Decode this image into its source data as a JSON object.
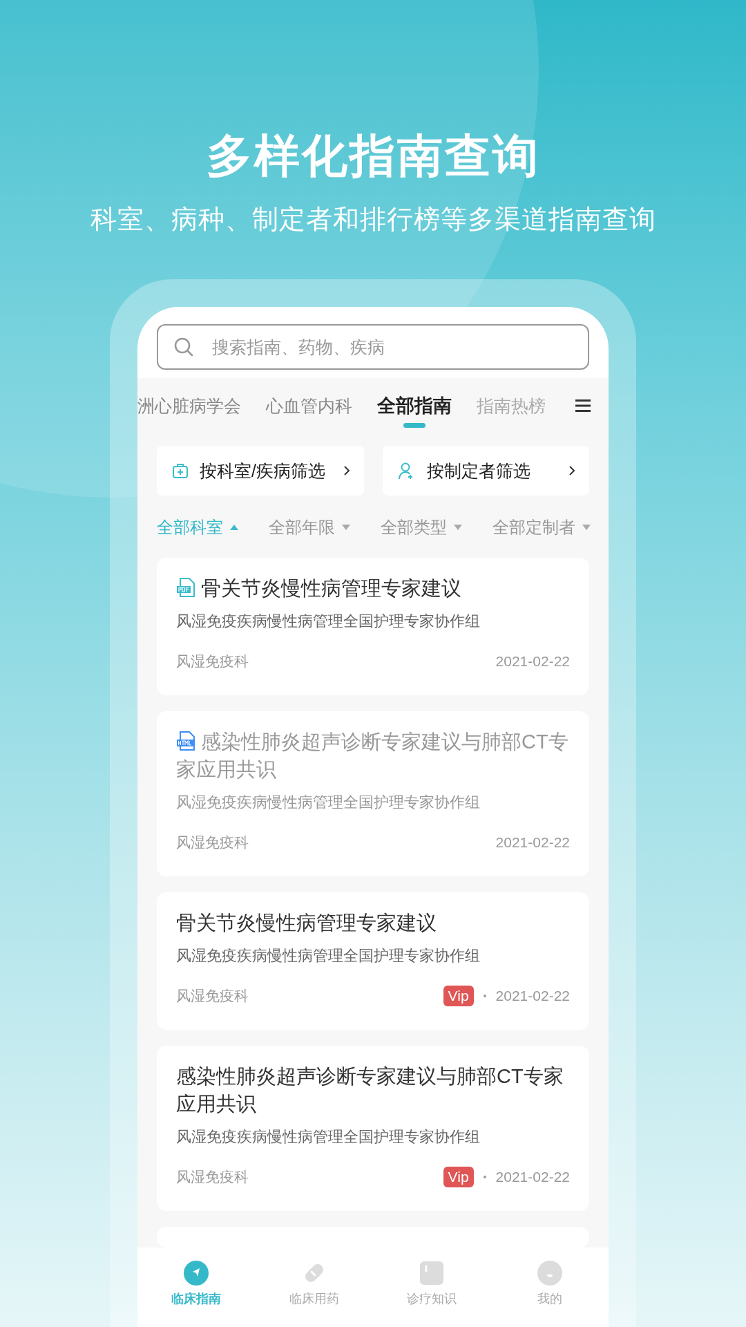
{
  "header": {
    "title": "多样化指南查询",
    "subtitle": "科室、病种、制定者和排行榜等多渠道指南查询"
  },
  "search": {
    "placeholder": "搜索指南、药物、疾病"
  },
  "tabs": [
    {
      "label": "洲心脏病学会",
      "selected": false
    },
    {
      "label": "心血管内科",
      "selected": false
    },
    {
      "label": "全部指南",
      "selected": true
    },
    {
      "label": "指南热榜",
      "selected": false
    }
  ],
  "filter_buttons": [
    {
      "label": "按科室/疾病筛选",
      "kind": "department"
    },
    {
      "label": "按制定者筛选",
      "kind": "author"
    }
  ],
  "dropdowns": [
    {
      "label": "全部科室",
      "expanded": true
    },
    {
      "label": "全部年限",
      "expanded": false
    },
    {
      "label": "全部类型",
      "expanded": false
    },
    {
      "label": "全部定制者",
      "expanded": false
    }
  ],
  "guidelines": [
    {
      "title": "骨关节炎慢性病管理专家建议",
      "org": "风湿免疫疾病慢性病管理全国护理专家协作组",
      "department": "风湿免疫科",
      "date": "2021-02-22",
      "kind": "pdf",
      "vip": false,
      "read": false
    },
    {
      "title": "感染性肺炎超声诊断专家建议与肺部CT专家应用共识",
      "org": "风湿免疫疾病慢性病管理全国护理专家协作组",
      "department": "风湿免疫科",
      "date": "2021-02-22",
      "kind": "html",
      "vip": false,
      "read": true
    },
    {
      "title": "骨关节炎慢性病管理专家建议",
      "org": "风湿免疫疾病慢性病管理全国护理专家协作组",
      "department": "风湿免疫科",
      "date": "2021-02-22",
      "kind": "plain",
      "badge": "Vip",
      "vip": true,
      "read": false
    },
    {
      "title": "感染性肺炎超声诊断专家建议与肺部CT专家应用共识",
      "org": "风湿免疫疾病慢性病管理全国护理专家协作组",
      "department": "风湿免疫科",
      "date": "2021-02-22",
      "kind": "plain",
      "badge": "Vip",
      "vip": true,
      "read": false
    }
  ],
  "nav": [
    {
      "label": "临床指南",
      "kind": "guide",
      "selected": true
    },
    {
      "label": "临床用药",
      "kind": "drug",
      "selected": false
    },
    {
      "label": "诊疗知识",
      "kind": "knowledge",
      "selected": false
    },
    {
      "label": "我的",
      "kind": "profile",
      "selected": false
    }
  ]
}
